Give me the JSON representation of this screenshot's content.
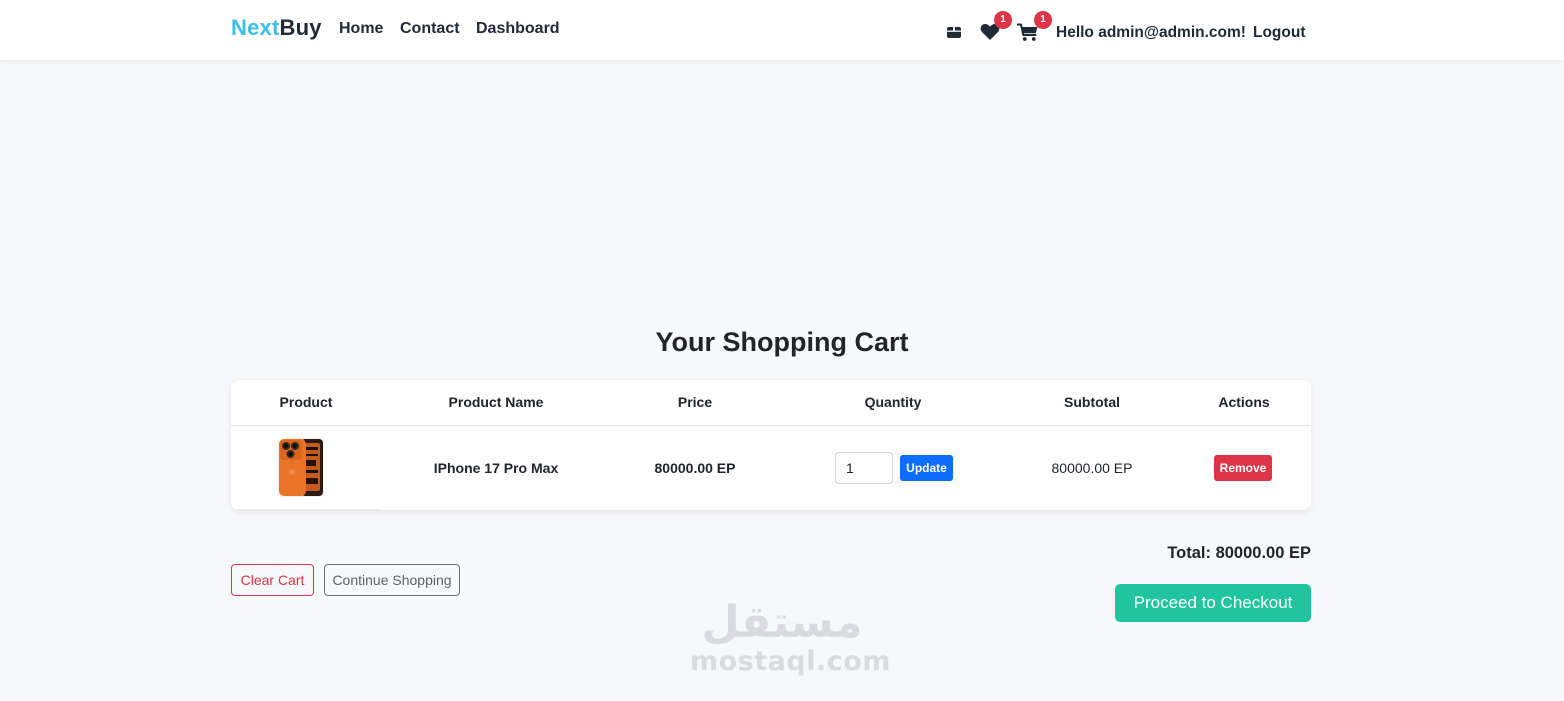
{
  "navbar": {
    "brand_first": "Next",
    "brand_second": "Buy",
    "links": [
      "Home",
      "Contact",
      "Dashboard"
    ],
    "icons": [
      "box-icon",
      "heart-icon",
      "cart-icon"
    ],
    "wishlist_count": "1",
    "cart_count": "1",
    "greeting": "Hello admin@admin.com!",
    "logout_label": "Logout"
  },
  "page": {
    "title": "Your Shopping Cart"
  },
  "cart": {
    "headers": [
      "Product",
      "Product Name",
      "Price",
      "Quantity",
      "Subtotal",
      "Actions"
    ],
    "items": [
      {
        "image": "phone-image",
        "name": "IPhone 17 Pro Max",
        "price": "80000.00 EP",
        "quantity": "1",
        "update_label": "Update",
        "subtotal": "80000.00 EP",
        "remove_label": "Remove"
      }
    ]
  },
  "actions": {
    "clear_label": "Clear Cart",
    "continue_label": "Continue Shopping"
  },
  "summary": {
    "total_text": "Total: 80000.00 EP",
    "checkout_label": "Proceed to Checkout"
  },
  "watermark": {
    "arabic": "مستقل",
    "latin": "mostaql.com"
  },
  "colors": {
    "brand_accent": "#3bbfe6",
    "primary": "#0d6efd",
    "danger": "#dc3545",
    "checkout": "#20c5a0",
    "background": "#f7f8fa"
  }
}
